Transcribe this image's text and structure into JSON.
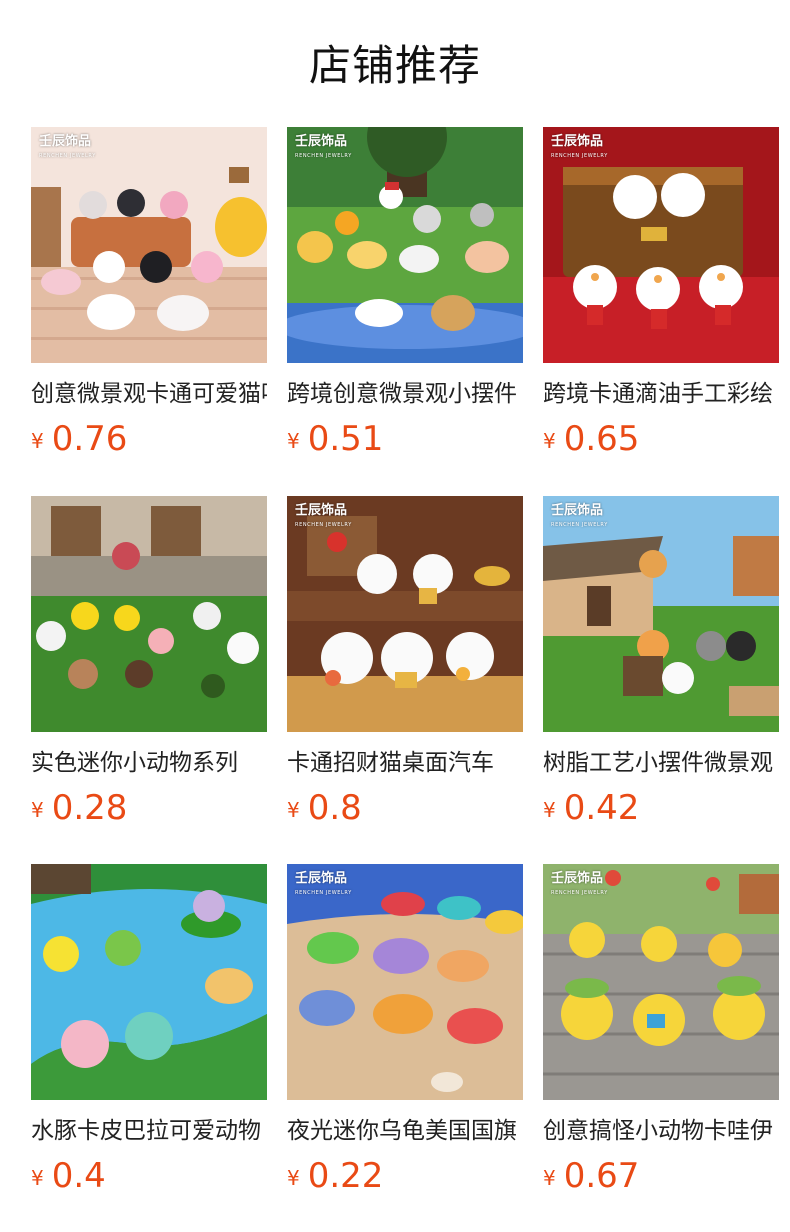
{
  "section": {
    "title": "店铺推荐"
  },
  "currency_symbol": "¥",
  "accent_color": "#e94a15",
  "products": [
    {
      "name": "创意微景观卡通可爱猫咪",
      "price": "0.76",
      "brand": "壬辰饰品",
      "brand_sub": "RENCHEN JEWELRY"
    },
    {
      "name": "跨境创意微景观小摆件",
      "price": "0.51",
      "brand": "壬辰饰品",
      "brand_sub": "RENCHEN JEWELRY"
    },
    {
      "name": "跨境卡通滴油手工彩绘",
      "price": "0.65",
      "brand": "壬辰饰品",
      "brand_sub": "RENCHEN JEWELRY"
    },
    {
      "name": "实色迷你小动物系列",
      "price": "0.28",
      "brand": "",
      "brand_sub": ""
    },
    {
      "name": "卡通招财猫桌面汽车",
      "price": "0.8",
      "brand": "壬辰饰品",
      "brand_sub": "RENCHEN JEWELRY"
    },
    {
      "name": "树脂工艺小摆件微景观",
      "price": "0.42",
      "brand": "壬辰饰品",
      "brand_sub": "RENCHEN JEWELRY"
    },
    {
      "name": "水豚卡皮巴拉可爱动物",
      "price": "0.4",
      "brand": "",
      "brand_sub": ""
    },
    {
      "name": "夜光迷你乌龟美国国旗",
      "price": "0.22",
      "brand": "壬辰饰品",
      "brand_sub": "RENCHEN JEWELRY"
    },
    {
      "name": "创意搞怪小动物卡哇伊",
      "price": "0.67",
      "brand": "壬辰饰品",
      "brand_sub": "RENCHEN JEWELRY"
    }
  ]
}
